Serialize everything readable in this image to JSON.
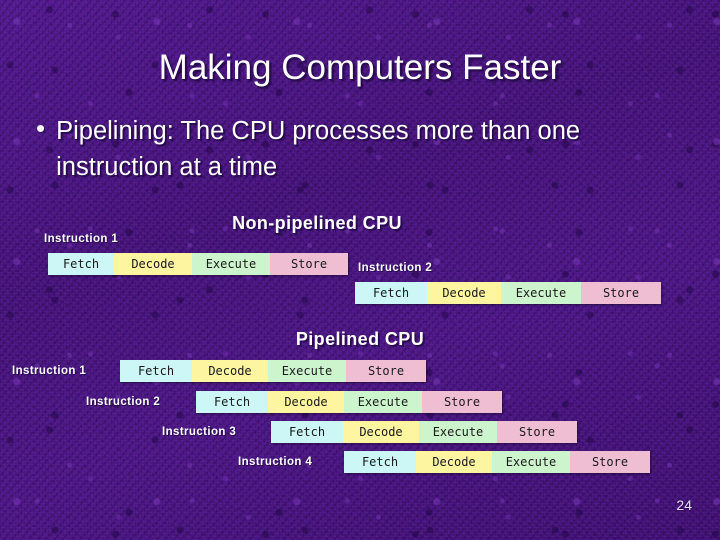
{
  "slide": {
    "title": "Making Computers Faster",
    "bullet_marker": "•",
    "bullet_text": "Pipelining: The CPU processes more than one instruction at a time",
    "page_number": "24",
    "background_color": "#4a1680",
    "text_color": "#ffffff"
  },
  "stage_colors": {
    "fetch": "#cdf7f7",
    "decode": "#fdf5a0",
    "execute": "#cdf5cd",
    "store": "#f0bed2"
  },
  "sections": [
    {
      "heading": "Non-pipelined CPU",
      "rows": [
        {
          "label": "Instruction 1",
          "stages": [
            {
              "name": "Fetch",
              "color_key": "fetch"
            },
            {
              "name": "Decode",
              "color_key": "decode"
            },
            {
              "name": "Execute",
              "color_key": "execute"
            },
            {
              "name": "Store",
              "color_key": "store"
            }
          ]
        },
        {
          "label": "Instruction 2",
          "stages": [
            {
              "name": "Fetch",
              "color_key": "fetch"
            },
            {
              "name": "Decode",
              "color_key": "decode"
            },
            {
              "name": "Execute",
              "color_key": "execute"
            },
            {
              "name": "Store",
              "color_key": "store"
            }
          ]
        }
      ]
    },
    {
      "heading": "Pipelined CPU",
      "rows": [
        {
          "label": "Instruction 1",
          "stages": [
            {
              "name": "Fetch",
              "color_key": "fetch"
            },
            {
              "name": "Decode",
              "color_key": "decode"
            },
            {
              "name": "Execute",
              "color_key": "execute"
            },
            {
              "name": "Store",
              "color_key": "store"
            }
          ]
        },
        {
          "label": "Instruction 2",
          "stages": [
            {
              "name": "Fetch",
              "color_key": "fetch"
            },
            {
              "name": "Decode",
              "color_key": "decode"
            },
            {
              "name": "Execute",
              "color_key": "execute"
            },
            {
              "name": "Store",
              "color_key": "store"
            }
          ]
        },
        {
          "label": "Instruction 3",
          "stages": [
            {
              "name": "Fetch",
              "color_key": "fetch"
            },
            {
              "name": "Decode",
              "color_key": "decode"
            },
            {
              "name": "Execute",
              "color_key": "execute"
            },
            {
              "name": "Store",
              "color_key": "store"
            }
          ]
        },
        {
          "label": "Instruction 4",
          "stages": [
            {
              "name": "Fetch",
              "color_key": "fetch"
            },
            {
              "name": "Decode",
              "color_key": "decode"
            },
            {
              "name": "Execute",
              "color_key": "execute"
            },
            {
              "name": "Store",
              "color_key": "store"
            }
          ]
        }
      ]
    }
  ]
}
